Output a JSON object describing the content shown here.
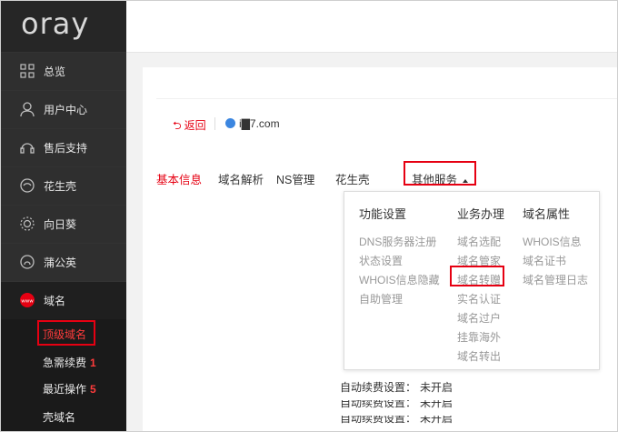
{
  "logo": "oray",
  "sidebar": {
    "items": [
      {
        "label": "总览",
        "icon": "grid-icon"
      },
      {
        "label": "用户中心",
        "icon": "user-icon"
      },
      {
        "label": "售后支持",
        "icon": "headset-icon"
      },
      {
        "label": "花生壳",
        "icon": "peanut-icon"
      },
      {
        "label": "向日葵",
        "icon": "sunflower-icon"
      },
      {
        "label": "蒲公英",
        "icon": "dandelion-icon"
      },
      {
        "label": "域名",
        "icon": "www-icon"
      }
    ],
    "sub_items": [
      {
        "label": "顶级域名",
        "badge": ""
      },
      {
        "label": "急需续费",
        "badge": "1"
      },
      {
        "label": "最近操作",
        "badge": "5"
      },
      {
        "label": "壳域名",
        "badge": ""
      }
    ]
  },
  "breadcrumb": {
    "back": "返回",
    "domain": "i▇7.com"
  },
  "tabs": [
    {
      "label": "基本信息",
      "active": true
    },
    {
      "label": "域名解析",
      "active": false
    },
    {
      "label": "NS管理",
      "active": false
    },
    {
      "label": "花生壳",
      "active": false
    },
    {
      "label": "其他服务",
      "active": false
    }
  ],
  "dropdown": {
    "columns": [
      {
        "title": "功能设置",
        "items": [
          "DNS服务器注册",
          "状态设置",
          "WHOIS信息隐藏",
          "自助管理"
        ]
      },
      {
        "title": "业务办理",
        "items": [
          "域名选配",
          "域名管家",
          "域名转赠",
          "实名认证",
          "域名过户",
          "挂靠海外",
          "域名转出"
        ]
      },
      {
        "title": "域名属性",
        "items": [
          "WHOIS信息",
          "域名证书",
          "域名管理日志"
        ]
      }
    ]
  },
  "renew": {
    "label": "自动续费设置：",
    "value": "未开启"
  },
  "colors": {
    "accent": "#e60012",
    "sidebar_bg": "#262626"
  }
}
